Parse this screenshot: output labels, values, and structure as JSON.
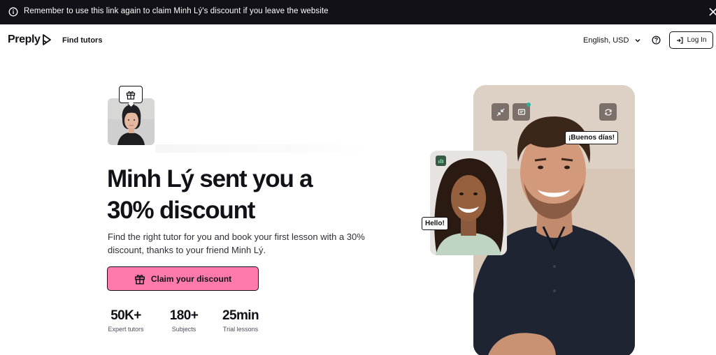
{
  "banner": {
    "text": "Remember to use this link again to claim Minh Lý's discount if you leave the website",
    "info_icon": "info-circle-icon",
    "close_icon": "close-icon"
  },
  "header": {
    "logo_text": "Preply",
    "nav_find_tutors": "Find tutors",
    "language_currency": "English, USD",
    "help_icon": "question-circle-icon",
    "login_label": "Log In"
  },
  "hero": {
    "headline_line1": "Minh Lý sent you a",
    "headline_line2": "30% discount",
    "subtitle": "Find the right tutor for you and book your first lesson with a 30% discount, thanks to your friend Minh Lý.",
    "cta_label": "Claim your discount",
    "stats": [
      {
        "value": "50K+",
        "label": "Expert tutors"
      },
      {
        "value": "180+",
        "label": "Subjects"
      },
      {
        "value": "25min",
        "label": "Trial lessons"
      }
    ]
  },
  "video": {
    "bubble_main": "¡Buenos días!",
    "bubble_small": "Hello!"
  },
  "colors": {
    "banner_bg": "#121117",
    "cta_bg": "#ff7aac",
    "text": "#121117",
    "status_dot": "#2bb09a"
  }
}
